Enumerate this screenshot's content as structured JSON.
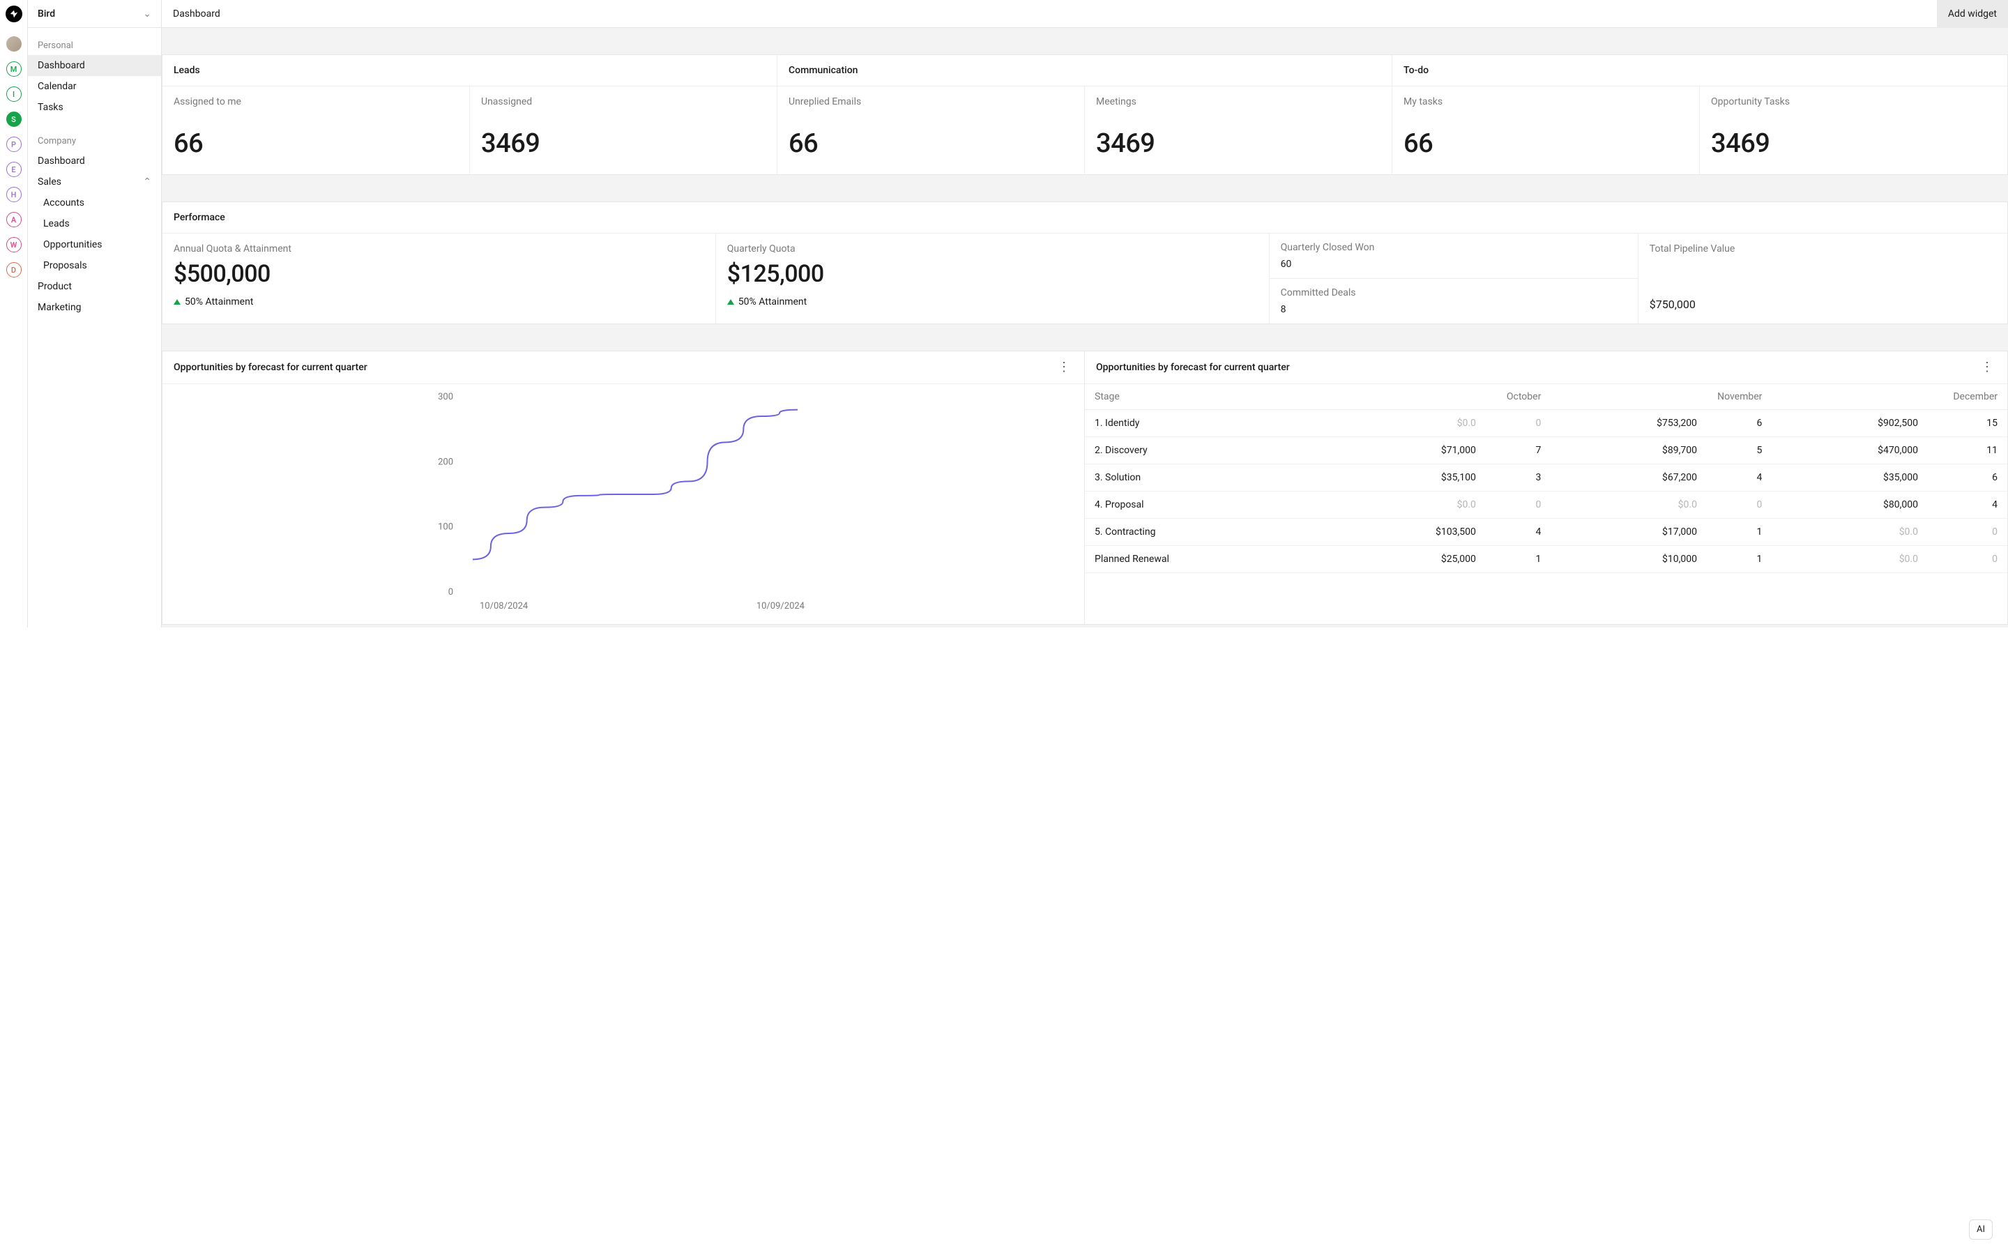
{
  "workspace": {
    "name": "Bird"
  },
  "rail": {
    "avatars": [
      {
        "letter": "M",
        "color": "#17a34a"
      },
      {
        "letter": "I",
        "color": "#17a34a"
      },
      {
        "letter": "S",
        "color": "#17a34a",
        "filled": true
      },
      {
        "letter": "P",
        "color": "#9b6dd7"
      },
      {
        "letter": "E",
        "color": "#9b6dd7"
      },
      {
        "letter": "H",
        "color": "#9b6dd7"
      },
      {
        "letter": "A",
        "color": "#d64a8a"
      },
      {
        "letter": "W",
        "color": "#d64a8a"
      },
      {
        "letter": "D",
        "color": "#e06a4a"
      }
    ]
  },
  "sidebar": {
    "personal_label": "Personal",
    "personal": {
      "dashboard": "Dashboard",
      "calendar": "Calendar",
      "tasks": "Tasks"
    },
    "company_label": "Company",
    "company": {
      "dashboard": "Dashboard",
      "sales": "Sales",
      "sales_children": {
        "accounts": "Accounts",
        "leads": "Leads",
        "opportunities": "Opportunities",
        "proposals": "Proposals"
      },
      "product": "Product",
      "marketing": "Marketing"
    }
  },
  "topbar": {
    "title": "Dashboard",
    "add_widget": "Add widget"
  },
  "kpi_sections": {
    "leads": "Leads",
    "communication": "Communication",
    "todo": "To-do"
  },
  "kpis": {
    "assigned": {
      "label": "Assigned to me",
      "value": "66"
    },
    "unassigned": {
      "label": "Unassigned",
      "value": "3469"
    },
    "unreplied": {
      "label": "Unreplied Emails",
      "value": "66"
    },
    "meetings": {
      "label": "Meetings",
      "value": "3469"
    },
    "mytasks": {
      "label": "My tasks",
      "value": "66"
    },
    "opptasks": {
      "label": "Opportunity Tasks",
      "value": "3469"
    }
  },
  "performance": {
    "title": "Performace",
    "annual": {
      "label": "Annual Quota & Attainment",
      "value": "$500,000",
      "attain": "50% Attainment"
    },
    "quarterly": {
      "label": "Quarterly Quota",
      "value": "$125,000",
      "attain": "50% Attainment"
    },
    "closedwon": {
      "label": "Quarterly Closed Won",
      "value": "60"
    },
    "committed": {
      "label": "Committed Deals",
      "value": "8"
    },
    "pipeline": {
      "label": "Total Pipeline Value",
      "value": "$750,000"
    }
  },
  "chart_card": {
    "title": "Opportunities by forecast for current quarter"
  },
  "chart_data": {
    "type": "line",
    "x": [
      "10/08/2024",
      "10/09/2024"
    ],
    "ylim": [
      0,
      300
    ],
    "yticks": [
      0,
      100,
      200,
      300
    ],
    "series": [
      {
        "name": "Opportunities",
        "values": [
          50,
          280
        ]
      }
    ],
    "curve_hint": [
      50,
      90,
      130,
      148,
      150,
      150,
      170,
      230,
      270,
      280
    ]
  },
  "table_card": {
    "title": "Opportunities by forecast for current quarter",
    "columns": {
      "stage": "Stage",
      "m1": "October",
      "m2": "November",
      "m3": "December"
    },
    "rows": [
      {
        "stage": "1. Identidy",
        "m1a": "$0.0",
        "m1c": "0",
        "m1z": true,
        "m2a": "$753,200",
        "m2c": "6",
        "m3a": "$902,500",
        "m3c": "15"
      },
      {
        "stage": "2. Discovery",
        "m1a": "$71,000",
        "m1c": "7",
        "m2a": "$89,700",
        "m2c": "5",
        "m3a": "$470,000",
        "m3c": "11"
      },
      {
        "stage": "3. Solution",
        "m1a": "$35,100",
        "m1c": "3",
        "m2a": "$67,200",
        "m2c": "4",
        "m3a": "$35,000",
        "m3c": "6"
      },
      {
        "stage": "4. Proposal",
        "m1a": "$0.0",
        "m1c": "0",
        "m1z": true,
        "m2a": "$0.0",
        "m2c": "0",
        "m2z": true,
        "m3a": "$80,000",
        "m3c": "4"
      },
      {
        "stage": "5. Contracting",
        "m1a": "$103,500",
        "m1c": "4",
        "m2a": "$17,000",
        "m2c": "1",
        "m3a": "$0.0",
        "m3c": "0",
        "m3z": true
      },
      {
        "stage": "Planned Renewal",
        "m1a": "$25,000",
        "m1c": "1",
        "m2a": "$10,000",
        "m2c": "1",
        "m3a": "$0.0",
        "m3c": "0",
        "m3z": true
      }
    ]
  },
  "ai_fab": "AI"
}
